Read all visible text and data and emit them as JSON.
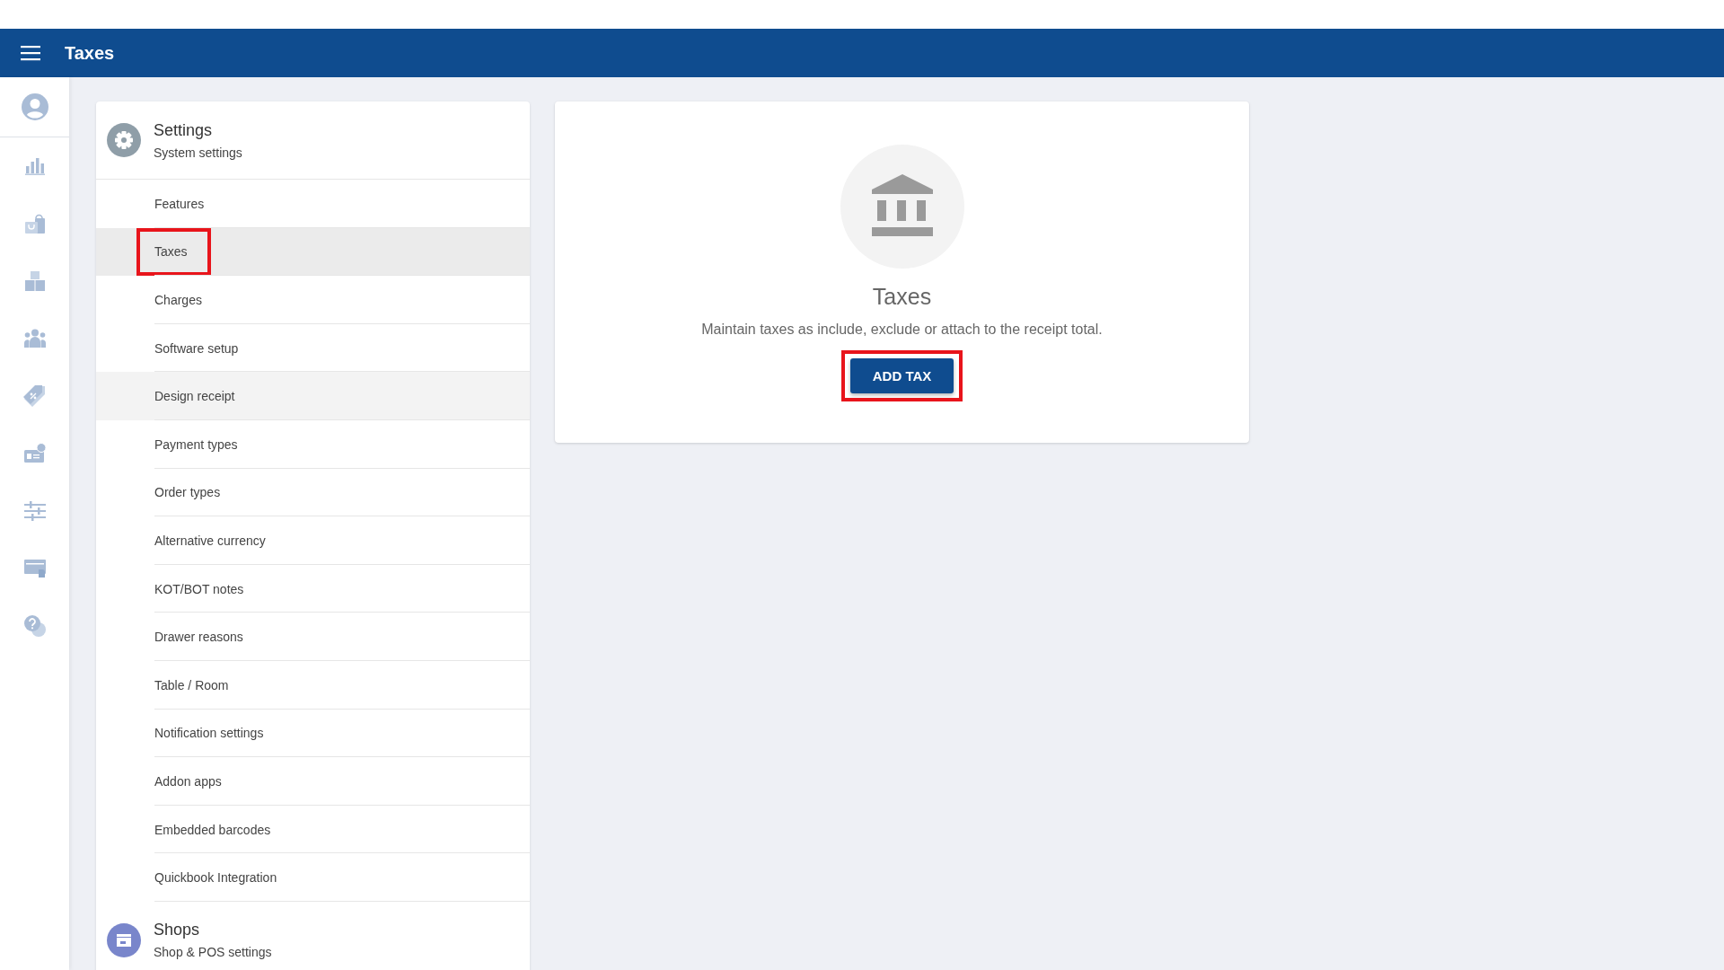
{
  "app_bar": {
    "title": "Taxes"
  },
  "sidebar": {
    "items": [
      {
        "kind": "avatar"
      },
      {
        "kind": "chart"
      },
      {
        "kind": "bag"
      },
      {
        "kind": "boxes"
      },
      {
        "kind": "people"
      },
      {
        "kind": "tag"
      },
      {
        "kind": "badge"
      },
      {
        "kind": "sliders"
      },
      {
        "kind": "card"
      },
      {
        "kind": "help"
      }
    ]
  },
  "settings_panel": {
    "sections": [
      {
        "kind": "settings",
        "title": "Settings",
        "subtitle": "System settings",
        "items": [
          {
            "label": "Features",
            "selected": false,
            "hovered": false,
            "highlighted": false
          },
          {
            "label": "Taxes",
            "selected": true,
            "hovered": false,
            "highlighted": true
          },
          {
            "label": "Charges",
            "selected": false,
            "hovered": false,
            "highlighted": false
          },
          {
            "label": "Software setup",
            "selected": false,
            "hovered": false,
            "highlighted": false
          },
          {
            "label": "Design receipt",
            "selected": false,
            "hovered": true,
            "highlighted": false
          },
          {
            "label": "Payment types",
            "selected": false,
            "hovered": false,
            "highlighted": false
          },
          {
            "label": "Order types",
            "selected": false,
            "hovered": false,
            "highlighted": false
          },
          {
            "label": "Alternative currency",
            "selected": false,
            "hovered": false,
            "highlighted": false
          },
          {
            "label": "KOT/BOT notes",
            "selected": false,
            "hovered": false,
            "highlighted": false
          },
          {
            "label": "Drawer reasons",
            "selected": false,
            "hovered": false,
            "highlighted": false
          },
          {
            "label": "Table / Room",
            "selected": false,
            "hovered": false,
            "highlighted": false
          },
          {
            "label": "Notification settings",
            "selected": false,
            "hovered": false,
            "highlighted": false
          },
          {
            "label": "Addon apps",
            "selected": false,
            "hovered": false,
            "highlighted": false
          },
          {
            "label": "Embedded barcodes",
            "selected": false,
            "hovered": false,
            "highlighted": false
          },
          {
            "label": "Quickbook Integration",
            "selected": false,
            "hovered": false,
            "highlighted": false
          }
        ]
      },
      {
        "kind": "shops",
        "title": "Shops",
        "subtitle": "Shop & POS settings"
      }
    ]
  },
  "empty_state": {
    "title": "Taxes",
    "description": "Maintain taxes as include, exclude or attach to the receipt total.",
    "button": {
      "label": "ADD TAX",
      "highlighted": true
    }
  }
}
